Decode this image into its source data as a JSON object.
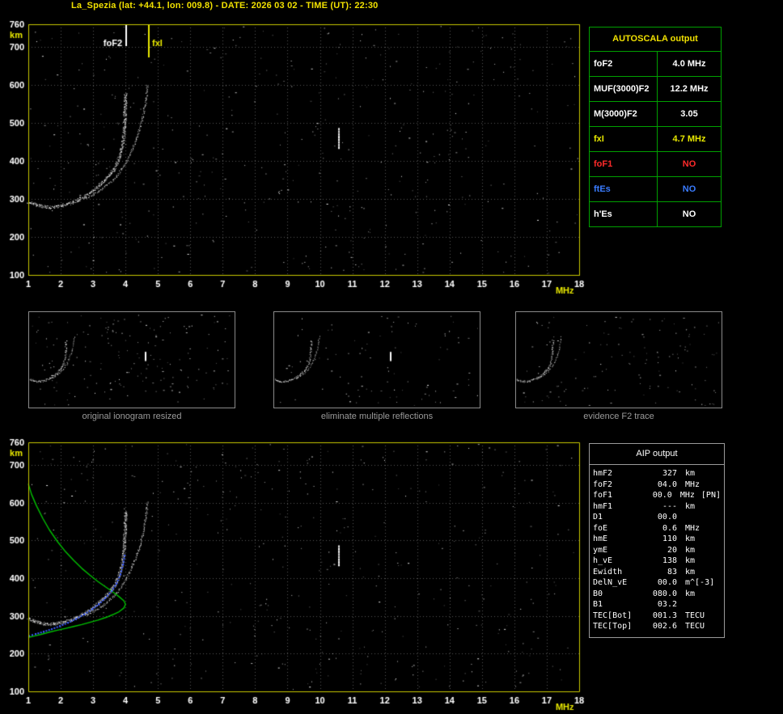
{
  "header": {
    "title": "La_Spezia (lat: +44.1, lon: 009.8) - DATE: 2026 03 02 - TIME (UT): 22:30"
  },
  "colors": {
    "background": "#000000",
    "title": "#f0e000",
    "frame": "#c8c800",
    "grid": "#565656",
    "axis_text": "#ffffff",
    "unit_text": "#e8e800",
    "trace": "#ffffff",
    "green_profile": "#00c000",
    "blue_trace": "#3a5cff",
    "yellow": "#e8e800",
    "red": "#ff2a2a",
    "blue": "#3a7cff",
    "caption": "#9a9a9a",
    "autoscala_border": "#00a000",
    "aip_border": "#9a9a9a"
  },
  "autoscala": {
    "title": "AUTOSCALA output",
    "rows": [
      {
        "label": "foF2",
        "value": "4.0 MHz",
        "color": "#ffffff",
        "value_color": "#ffffff"
      },
      {
        "label": "MUF(3000)F2",
        "value": "12.2 MHz",
        "color": "#ffffff",
        "value_color": "#ffffff"
      },
      {
        "label": "M(3000)F2",
        "value": "3.05",
        "color": "#ffffff",
        "value_color": "#ffffff"
      },
      {
        "label": "fxI",
        "value": "4.7 MHz",
        "color": "#e8e800",
        "value_color": "#e8e800"
      },
      {
        "label": "foF1",
        "value": "NO",
        "color": "#ff2a2a",
        "value_color": "#ff2a2a"
      },
      {
        "label": "ftEs",
        "value": "NO",
        "color": "#3a7cff",
        "value_color": "#3a7cff"
      },
      {
        "label": "h'Es",
        "value": "NO",
        "color": "#ffffff",
        "value_color": "#ffffff"
      }
    ]
  },
  "thumbnails": [
    {
      "caption": "original ionogram resized"
    },
    {
      "caption": "eliminate multiple reflections"
    },
    {
      "caption": "evidence F2 trace"
    }
  ],
  "aip": {
    "title": "AIP output",
    "rows": [
      {
        "name": "hmF2",
        "value": "327",
        "unit": "km",
        "extra": ""
      },
      {
        "name": "foF2",
        "value": "04.0",
        "unit": "MHz",
        "extra": ""
      },
      {
        "name": "foF1",
        "value": "00.0",
        "unit": "MHz",
        "extra": "[PN]"
      },
      {
        "name": "hmF1",
        "value": "---",
        "unit": "km",
        "extra": ""
      },
      {
        "name": "D1",
        "value": "00.0",
        "unit": "",
        "extra": ""
      },
      {
        "name": "foE",
        "value": "0.6",
        "unit": "MHz",
        "extra": ""
      },
      {
        "name": "hmE",
        "value": "110",
        "unit": "km",
        "extra": ""
      },
      {
        "name": "ymE",
        "value": "20",
        "unit": "km",
        "extra": ""
      },
      {
        "name": "h_vE",
        "value": "138",
        "unit": "km",
        "extra": ""
      },
      {
        "name": "Ewidth",
        "value": "83",
        "unit": "km",
        "extra": ""
      },
      {
        "name": "DelN_vE",
        "value": "00.0",
        "unit": "m^[-3]",
        "extra": ""
      },
      {
        "name": "B0",
        "value": "080.0",
        "unit": "km",
        "extra": ""
      },
      {
        "name": "B1",
        "value": "03.2",
        "unit": "",
        "extra": ""
      },
      {
        "name": "TEC[Bot]",
        "value": "001.3",
        "unit": "TECU",
        "extra": ""
      },
      {
        "name": "TEC[Top]",
        "value": "002.6",
        "unit": "TECU",
        "extra": ""
      }
    ]
  },
  "chart_data": {
    "type": "scatter",
    "title": "Ionogram with AUTOSCALA interpretation",
    "axis": {
      "x_unit": "MHz",
      "y_unit": "km"
    },
    "x_range": [
      1,
      18
    ],
    "y_range": [
      100,
      760
    ],
    "x_ticks": [
      1,
      2,
      3,
      4,
      5,
      6,
      7,
      8,
      9,
      10,
      11,
      12,
      13,
      14,
      15,
      16,
      17,
      18
    ],
    "y_ticks": [
      760,
      700,
      600,
      500,
      400,
      300,
      200,
      100
    ],
    "grid": true,
    "markers": {
      "foF2_label": "foF2",
      "foF2_f": 4.0,
      "fxI_label": "fxI",
      "fxI_f": 4.7
    },
    "scaled_values": {
      "foF2_MHz": 4.0,
      "fxI_MHz": 4.7,
      "MUF3000F2_MHz": 12.2,
      "M3000F2": 3.05
    },
    "o_trace": [
      [
        1.0,
        293
      ],
      [
        1.15,
        287
      ],
      [
        1.3,
        283
      ],
      [
        1.5,
        280
      ],
      [
        1.7,
        279
      ],
      [
        1.9,
        281
      ],
      [
        2.1,
        285
      ],
      [
        2.3,
        290
      ],
      [
        2.5,
        297
      ],
      [
        2.7,
        306
      ],
      [
        2.9,
        317
      ],
      [
        3.1,
        330
      ],
      [
        3.3,
        345
      ],
      [
        3.45,
        358
      ],
      [
        3.6,
        374
      ],
      [
        3.7,
        389
      ],
      [
        3.8,
        410
      ],
      [
        3.87,
        432
      ],
      [
        3.92,
        455
      ],
      [
        3.95,
        480
      ],
      [
        3.97,
        510
      ],
      [
        3.985,
        545
      ],
      [
        3.995,
        580
      ]
    ],
    "x_trace": [
      [
        2.75,
        302
      ],
      [
        2.95,
        310
      ],
      [
        3.15,
        320
      ],
      [
        3.35,
        332
      ],
      [
        3.55,
        347
      ],
      [
        3.72,
        362
      ],
      [
        3.88,
        380
      ],
      [
        4.02,
        400
      ],
      [
        4.16,
        424
      ],
      [
        4.3,
        452
      ],
      [
        4.42,
        482
      ],
      [
        4.52,
        515
      ],
      [
        4.6,
        550
      ],
      [
        4.65,
        582
      ],
      [
        4.67,
        605
      ]
    ],
    "interference": {
      "f": 10.55,
      "h_from": 438,
      "h_to": 487
    },
    "green_profile": [
      [
        1.0,
        650
      ],
      [
        1.1,
        622
      ],
      [
        1.25,
        592
      ],
      [
        1.45,
        558
      ],
      [
        1.65,
        528
      ],
      [
        1.9,
        497
      ],
      [
        2.15,
        470
      ],
      [
        2.4,
        447
      ],
      [
        2.65,
        426
      ],
      [
        2.9,
        408
      ],
      [
        3.15,
        391
      ],
      [
        3.4,
        376
      ],
      [
        3.6,
        364
      ],
      [
        3.8,
        351
      ],
      [
        3.95,
        340
      ],
      [
        4.0,
        331
      ],
      [
        3.95,
        321
      ],
      [
        3.8,
        311
      ],
      [
        3.6,
        303
      ],
      [
        3.4,
        296
      ],
      [
        3.15,
        289
      ],
      [
        2.9,
        283
      ],
      [
        2.65,
        277
      ],
      [
        2.4,
        272
      ],
      [
        2.15,
        267
      ],
      [
        1.9,
        262
      ],
      [
        1.65,
        257
      ],
      [
        1.4,
        251
      ],
      [
        1.15,
        246
      ],
      [
        1.0,
        243
      ]
    ],
    "restored_o_trace": [
      [
        1.0,
        249
      ],
      [
        1.2,
        254
      ],
      [
        1.45,
        260
      ],
      [
        1.7,
        267
      ],
      [
        1.95,
        275
      ],
      [
        2.2,
        284
      ],
      [
        2.45,
        294
      ],
      [
        2.7,
        306
      ],
      [
        2.95,
        320
      ],
      [
        3.15,
        333
      ],
      [
        3.35,
        349
      ],
      [
        3.55,
        368
      ],
      [
        3.7,
        388
      ],
      [
        3.82,
        412
      ],
      [
        3.9,
        438
      ],
      [
        3.95,
        462
      ]
    ]
  }
}
